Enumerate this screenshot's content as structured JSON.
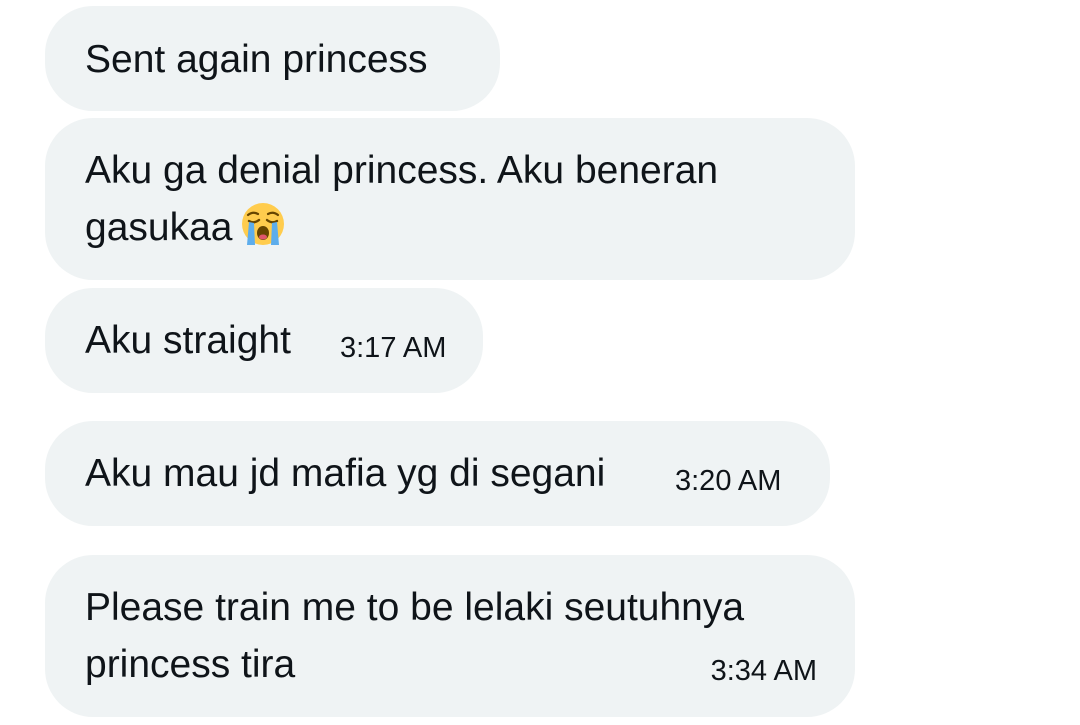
{
  "messages": [
    {
      "text": "Sent again princess"
    },
    {
      "line1": "Aku ga denial princess. Aku beneran",
      "line2": "gasukaa",
      "emoji": "loudly-crying-face"
    },
    {
      "text": "Aku straight",
      "time": "3:17 AM"
    },
    {
      "text": "Aku mau jd mafia yg di segani",
      "time": "3:20 AM"
    },
    {
      "line1": "Please train me to be lelaki seutuhnya",
      "line2": "princess tira",
      "time": "3:34 AM"
    }
  ],
  "colors": {
    "bubble_bg": "#eff3f4",
    "text": "#0f1419",
    "page_bg": "#ffffff"
  }
}
